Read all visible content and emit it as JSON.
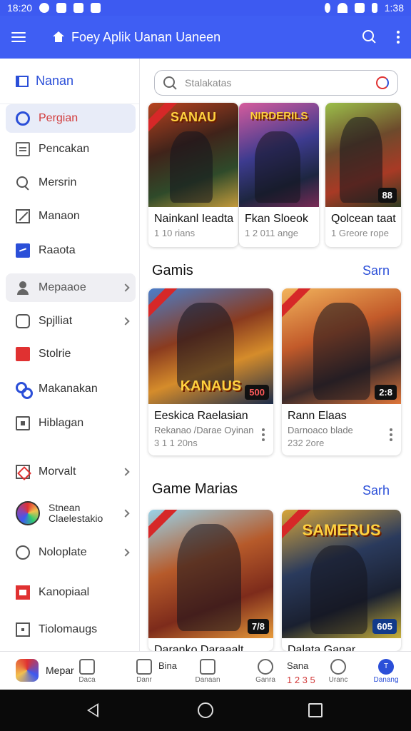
{
  "status_bar": {
    "time_left": "18:20",
    "time_right": "1:38"
  },
  "app_bar": {
    "title": "Foey Aplik Uanan Uaneen"
  },
  "sidebar": {
    "header": "Nanan",
    "items": [
      {
        "label": "Pergian",
        "icon": "target-icon"
      },
      {
        "label": "Pencakan",
        "icon": "document-icon"
      },
      {
        "label": "Mersrin",
        "icon": "search-icon"
      },
      {
        "label": "Manaon",
        "icon": "box-icon"
      },
      {
        "label": "Raaota",
        "icon": "chart-icon"
      },
      {
        "label": "Mepaaoe",
        "icon": "user-icon"
      },
      {
        "label": "Spjlliat",
        "icon": "chat-icon"
      },
      {
        "label": "Stolrie",
        "icon": "red-tag-icon"
      },
      {
        "label": "Makanakan",
        "icon": "link-icon"
      },
      {
        "label": "Hiblagan",
        "icon": "frame-icon"
      },
      {
        "label": "Morvalt",
        "icon": "film-icon"
      },
      {
        "label": "Stnean Claelestakio",
        "icon": "globe-icon"
      },
      {
        "label": "Noloplate",
        "icon": "circle-icon"
      },
      {
        "label": "Kanopiaal",
        "icon": "flag-icon"
      },
      {
        "label": "Tiolomaugs",
        "icon": "square-icon"
      }
    ]
  },
  "search": {
    "placeholder": "Stalakatas"
  },
  "top_row": [
    {
      "title": "Nainkanl Ieadta",
      "meta": "1 10 rians",
      "art_text": "SANAU",
      "badge": ""
    },
    {
      "title": "Fkan Sloeok",
      "meta": "1 2 011 ange",
      "art_text": "NIRDERILS",
      "badge": ""
    },
    {
      "title": "Qolcean  taat",
      "meta": "1 Greore rope",
      "art_text": "",
      "badge": "88"
    }
  ],
  "sections": [
    {
      "title": "Gamis",
      "see_all": "Sarn",
      "cards": [
        {
          "title": "Eeskica Raelasian",
          "subtitle": "Rekanao /Darae Oyinan",
          "meta": "3 1 1 20ns",
          "art_text": "KANAUS",
          "badge": "500"
        },
        {
          "title": "Rann Elaas",
          "subtitle": "Darnoaco blade",
          "meta": "232 2ore",
          "art_text": "",
          "badge": "2:8"
        }
      ]
    },
    {
      "title": "Game Marias",
      "see_all": "Sarh",
      "cards": [
        {
          "title": "Daranko Daraaalt",
          "art_text": "",
          "badge": "7/8"
        },
        {
          "title": "Dalata Ganar",
          "art_text": "SAMERUS",
          "badge": "605"
        }
      ]
    }
  ],
  "bottom_nav": {
    "app_label": "Mepar",
    "items": [
      {
        "label": "Daca"
      },
      {
        "label": "Danr"
      },
      {
        "label": "Danaan"
      },
      {
        "label": "Ganra"
      },
      {
        "label": "Uranc"
      },
      {
        "label": "Danang"
      }
    ],
    "overlay_top": "Bina",
    "overlay_right_1": "Sana",
    "overlay_right_2": "1 2 3 5"
  },
  "colors": {
    "accent": "#3f5ef3",
    "active": "#d23b3b",
    "link": "#2b4fd8"
  }
}
